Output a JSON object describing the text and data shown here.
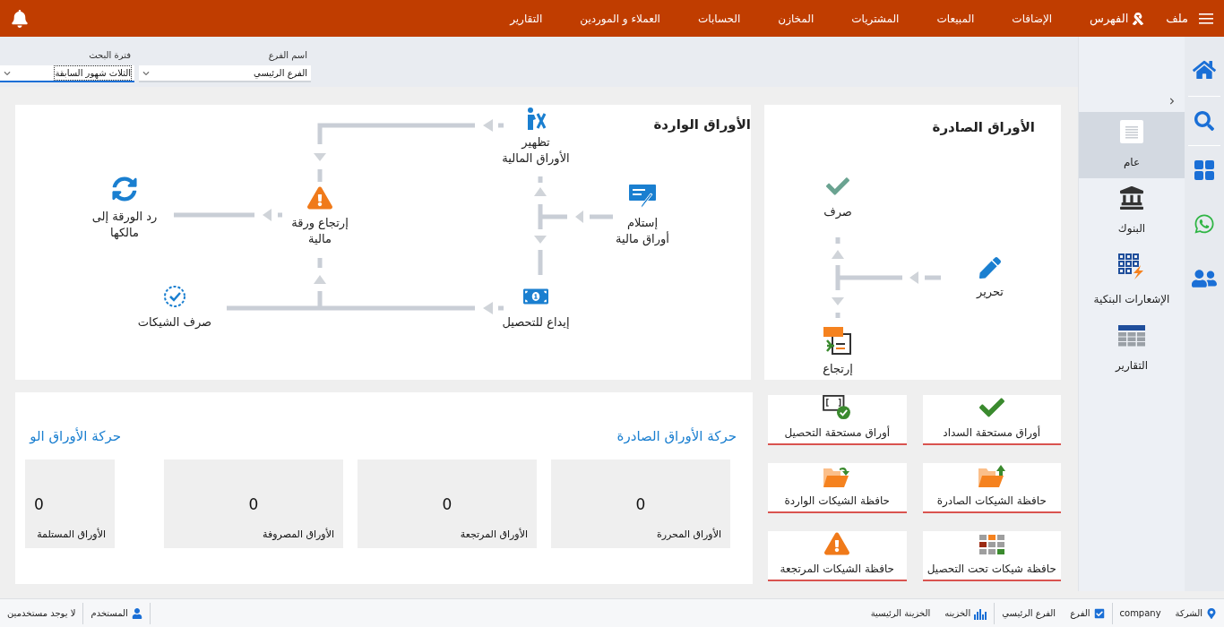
{
  "menu_bar": {
    "file": "ملف",
    "index": "الفهرس",
    "items": [
      "الإضافات",
      "المبيعات",
      "المشتريات",
      "المخازن",
      "الحسابات",
      "العملاء و الموردين",
      "التقارير"
    ]
  },
  "filters": [
    {
      "label": "اسم الفرع",
      "value": "الفرع الرئيسي",
      "focused": false
    },
    {
      "label": "فترة البحث",
      "value": "الثلاث شهور السابقة",
      "focused": true
    }
  ],
  "side_nav": [
    {
      "label": "عام",
      "selected": true
    },
    {
      "label": "البنوك",
      "selected": false
    },
    {
      "label": "الإشعارات البنكية",
      "selected": false
    },
    {
      "label": "التقارير",
      "selected": false
    }
  ],
  "outgoing_flow": {
    "title": "الأوراق الصادرة",
    "nodes": [
      {
        "lines": [
          "صرف"
        ]
      },
      {
        "lines": [
          "تحرير"
        ]
      },
      {
        "lines": [
          "إرتجاع"
        ]
      }
    ]
  },
  "incoming_flow": {
    "title": "الأوراق الواردة",
    "nodes": [
      {
        "lines": [
          "تظهير",
          "الأوراق المالية"
        ]
      },
      {
        "lines": [
          "إستلام",
          "أوراق مالية"
        ]
      },
      {
        "lines": [
          "إرتجاع ورقة",
          "مالية"
        ]
      },
      {
        "lines": [
          "رد الورقة إلى",
          "مالكها"
        ]
      },
      {
        "lines": [
          "إيداع للتحصيل"
        ]
      },
      {
        "lines": [
          "صرف الشيكات"
        ]
      }
    ]
  },
  "tiles": [
    "أوراق مستحقة السداد",
    "أوراق مستحقة التحصيل",
    "حافظة الشيكات الصادرة",
    "حافظة الشيكات الواردة",
    "حافظة شيكات تحت التحصيل",
    "حافظة الشيكات المرتجعة"
  ],
  "movement": [
    {
      "title": "حركة الأوراق الصادرة",
      "stats": [
        {
          "value": "0",
          "label": "الأوراق المحررة"
        },
        {
          "value": "0",
          "label": "الأوراق المرتجعة"
        },
        {
          "value": "0",
          "label": "الأوراق المصروفة"
        }
      ]
    },
    {
      "title": "حركة الأوراق الو",
      "stats": [
        {
          "value": "0",
          "label": "الأوراق المستلمة"
        }
      ]
    }
  ],
  "status_bar": {
    "company_label": "الشركة",
    "company": "company",
    "branch_label": "الفرع",
    "branch_checked": true,
    "branch": "الفرع الرئيسي",
    "treasury_label": "الخزينه",
    "treasury": "الخزينة الرئيسية",
    "user_label": "المستخدم",
    "user": "لا يوجد مستخدمين"
  }
}
